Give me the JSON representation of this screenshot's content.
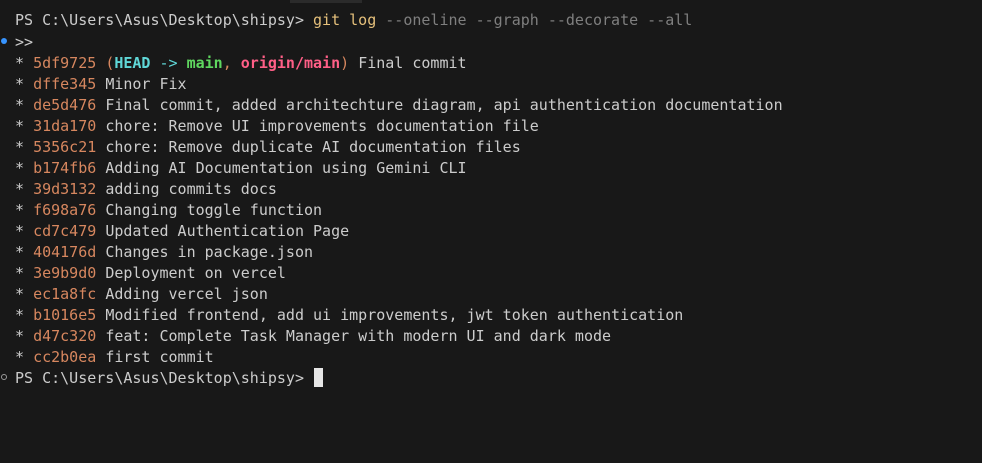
{
  "prompt": "PS C:\\Users\\Asus\\Desktop\\shipsy>",
  "command": {
    "name": "git log",
    "flags": "--oneline --graph --decorate --all"
  },
  "continuation": ">>",
  "graph_marker": "*",
  "head_commit": {
    "hash": "5df9725",
    "open_paren": "(",
    "head": "HEAD",
    "arrow": "->",
    "branch": "main",
    "comma": ",",
    "remote": "origin/main",
    "close_paren": ")",
    "message": "Final commit"
  },
  "commits": [
    {
      "hash": "dffe345",
      "message": "Minor Fix"
    },
    {
      "hash": "de5d476",
      "message": "Final commit, added architechture diagram, api authentication documentation"
    },
    {
      "hash": "31da170",
      "message": "chore: Remove UI improvements documentation file"
    },
    {
      "hash": "5356c21",
      "message": "chore: Remove duplicate AI documentation files"
    },
    {
      "hash": "b174fb6",
      "message": "Adding AI Documentation using Gemini CLI"
    },
    {
      "hash": "39d3132",
      "message": "adding commits docs"
    },
    {
      "hash": "f698a76",
      "message": "Changing toggle function"
    },
    {
      "hash": "cd7c479",
      "message": "Updated Authentication Page"
    },
    {
      "hash": "404176d",
      "message": "Changes in package.json"
    },
    {
      "hash": "3e9b9d0",
      "message": "Deployment on vercel"
    },
    {
      "hash": "ec1a8fc",
      "message": "Adding vercel json"
    },
    {
      "hash": "b1016e5",
      "message": "Modified frontend, add ui improvements, jwt token authentication"
    },
    {
      "hash": "d47c320",
      "message": "feat: Complete Task Manager with modern UI and dark mode"
    },
    {
      "hash": "cc2b0ea",
      "message": "first commit"
    }
  ],
  "colors": {
    "background": "#181818",
    "text": "#cccccc",
    "command": "#e5c07b",
    "flags": "#7f7f7f",
    "hash": "#d7875f",
    "head": "#5fd7d7",
    "branch": "#5fd75f",
    "remote": "#ff5f87",
    "success_marker": "#3794ff"
  }
}
